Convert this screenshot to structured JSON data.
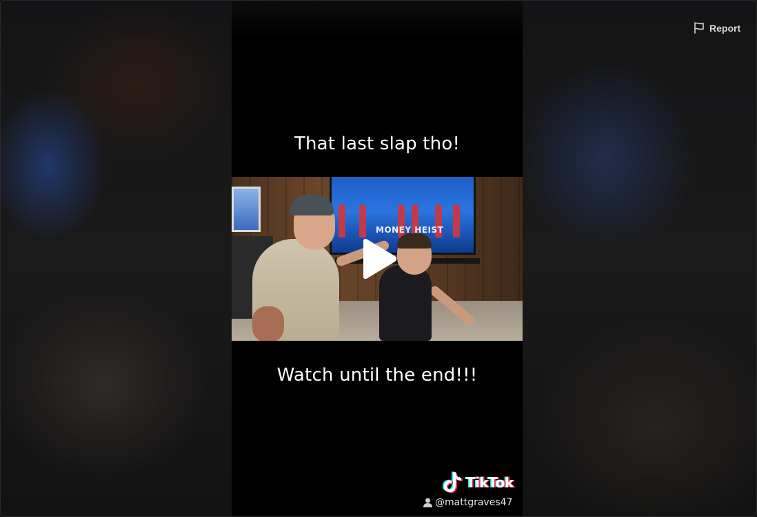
{
  "report": {
    "label": "Report",
    "icon": "flag-icon"
  },
  "video": {
    "caption_top": "That last slap tho!",
    "caption_bottom": "Watch until the end!!!",
    "tv_title": "MONEY HEIST",
    "play_icon": "play-icon"
  },
  "watermark": {
    "brand": "TikTok",
    "handle": "@mattgraves47",
    "logo_icon": "tiktok-logo-icon",
    "user_icon": "user-icon"
  },
  "colors": {
    "backdrop": "#111111",
    "video_bg": "#000000",
    "caption": "#ffffff",
    "tiktok_cyan": "#25f4ee",
    "tiktok_red": "#ff2b55"
  }
}
